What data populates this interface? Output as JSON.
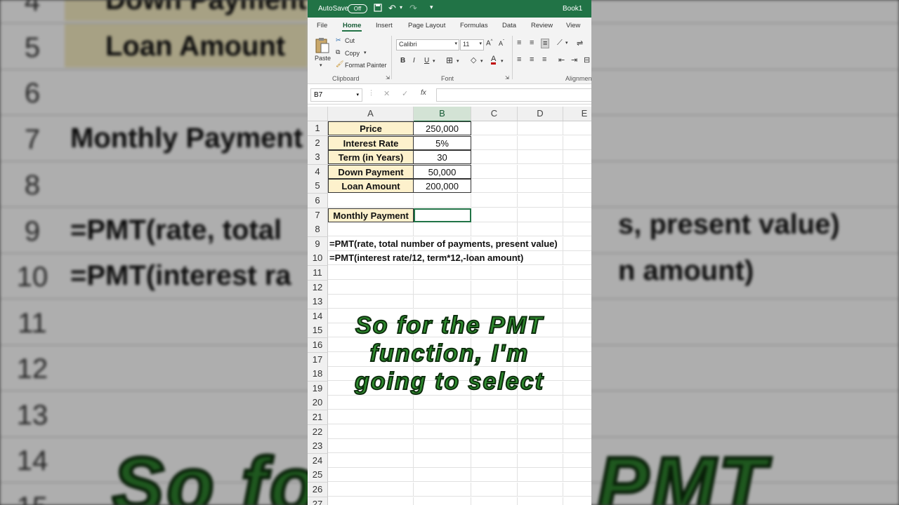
{
  "background": {
    "rows": [
      {
        "num": "4",
        "text": "Down Payment"
      },
      {
        "num": "5",
        "text": "Loan Amount"
      },
      {
        "num": "6",
        "text": ""
      },
      {
        "num": "7",
        "text": "Monthly Payment"
      },
      {
        "num": "8",
        "text": ""
      },
      {
        "num": "9",
        "text": "=PMT(rate, total"
      },
      {
        "num": "10",
        "text": "=PMT(interest ra"
      },
      {
        "num": "11",
        "text": ""
      },
      {
        "num": "12",
        "text": ""
      },
      {
        "num": "13",
        "text": ""
      },
      {
        "num": "14",
        "text": ""
      },
      {
        "num": "15",
        "text": ""
      }
    ],
    "right_texts": [
      "s, present value)",
      "n amount)"
    ],
    "caption_left": "So fo",
    "caption_right": "PMT"
  },
  "titlebar": {
    "autosave_label": "AutoSave",
    "autosave_state": "Off",
    "doc_title": "Book1"
  },
  "tabs": [
    "File",
    "Home",
    "Insert",
    "Page Layout",
    "Formulas",
    "Data",
    "Review",
    "View"
  ],
  "active_tab": "Home",
  "ribbon": {
    "clipboard": {
      "paste": "Paste",
      "cut": "Cut",
      "copy": "Copy",
      "format_painter": "Format Painter",
      "group": "Clipboard"
    },
    "font": {
      "name": "Calibri",
      "size": "11",
      "group": "Font",
      "bold": "B",
      "italic": "I",
      "underline": "U"
    },
    "alignment": {
      "group": "Alignmen"
    }
  },
  "formula_bar": {
    "name_box": "B7",
    "formula": ""
  },
  "columns": [
    "A",
    "B",
    "C",
    "D",
    "E"
  ],
  "sheet": {
    "rows": [
      {
        "num": "1",
        "a": "Price",
        "b": "250,000"
      },
      {
        "num": "2",
        "a": "Interest Rate",
        "b": "5%"
      },
      {
        "num": "3",
        "a": "Term (in Years)",
        "b": "30"
      },
      {
        "num": "4",
        "a": "Down Payment",
        "b": "50,000"
      },
      {
        "num": "5",
        "a": "Loan Amount",
        "b": "200,000"
      },
      {
        "num": "6"
      },
      {
        "num": "7",
        "a": "Monthly Payment",
        "b": ""
      },
      {
        "num": "8"
      },
      {
        "num": "9",
        "formula": "=PMT(rate, total number of payments, present value)"
      },
      {
        "num": "10",
        "formula": "=PMT(interest rate/12, term*12,-loan amount)"
      },
      {
        "num": "11"
      },
      {
        "num": "12"
      },
      {
        "num": "13"
      },
      {
        "num": "14"
      },
      {
        "num": "15"
      },
      {
        "num": "16"
      },
      {
        "num": "17"
      },
      {
        "num": "18"
      },
      {
        "num": "19"
      },
      {
        "num": "20"
      },
      {
        "num": "21"
      },
      {
        "num": "22"
      },
      {
        "num": "23"
      },
      {
        "num": "24"
      },
      {
        "num": "25"
      },
      {
        "num": "26"
      },
      {
        "num": "27"
      }
    ]
  },
  "caption": {
    "line1": "So for the PMT",
    "line2": "function, I'm",
    "line3": "going to select"
  },
  "colors": {
    "excel_green": "#217346",
    "label_fill": "#fdf1cc",
    "caption_green": "#2e8b2e"
  }
}
